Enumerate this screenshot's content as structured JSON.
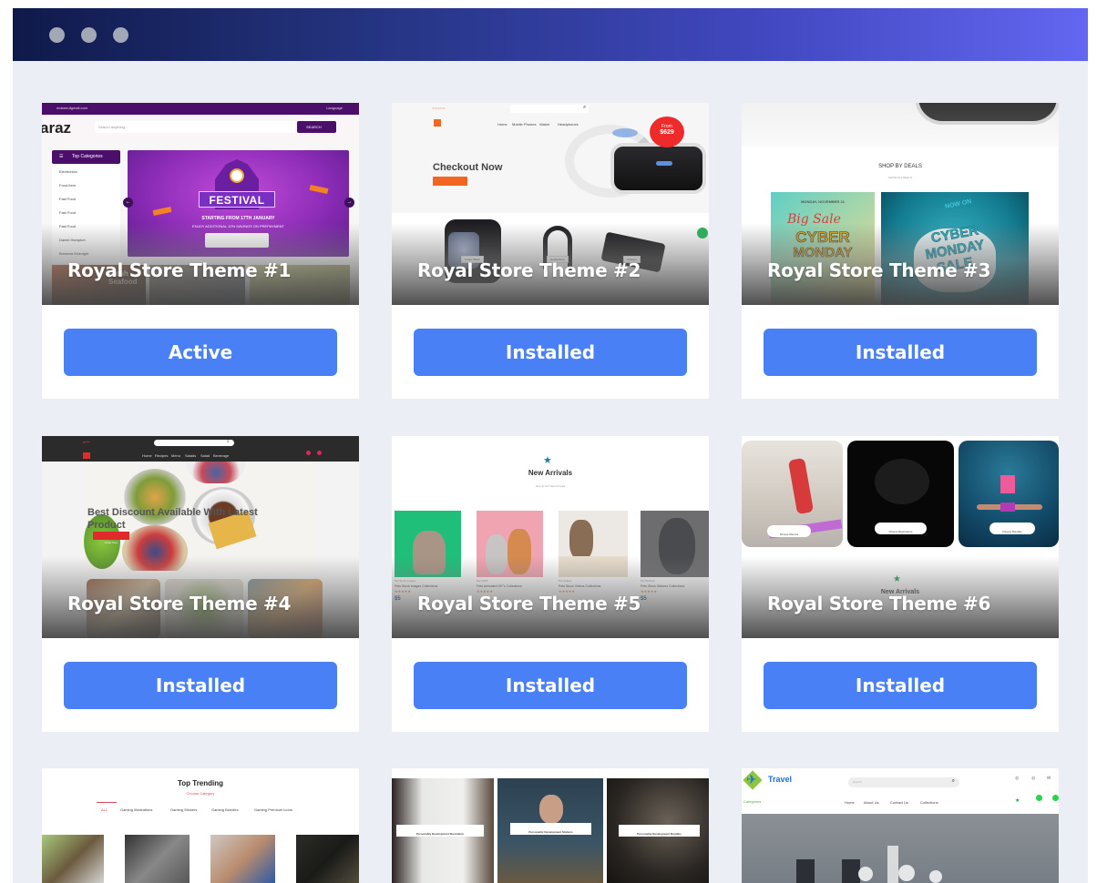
{
  "window": {
    "controls": [
      "close-dot",
      "minimize-dot",
      "maximize-dot"
    ]
  },
  "themes": [
    {
      "title": "Royal Store Theme #1",
      "button": "Active",
      "preview": {
        "email": "mdamrufgmail.com",
        "language": "Language",
        "logo": "araz",
        "search_placeholder": "Search anything...",
        "search_button": "SEARCH",
        "categories_header": "Top Categories",
        "categories": [
          "Electronics",
          "Food Item",
          "Fast Food",
          "Fast Food",
          "Fast Food",
          "Daniel Hampton",
          "Breanna Mcknight"
        ],
        "banner_title": "FESTIVAL",
        "banner_line1": "STARTING FROM 17TH JANUARY",
        "banner_line2": "ENJOY ADDITIONAL 10% SAVINGS ON PREPAYMENT",
        "tile_text": "Fresh Seafood"
      }
    },
    {
      "title": "Royal Store Theme #2",
      "button": "Installed",
      "preview": {
        "nav": [
          "Home",
          "Mobile Phones",
          "Watch",
          "Headphones"
        ],
        "hero_title": "Checkout Now",
        "hero_button": "Shop Now",
        "price_from": "From",
        "price": "$629",
        "product_labels": [
          "Smart Watch",
          "Headphone",
          "Charger"
        ]
      }
    },
    {
      "title": "Royal Store Theme #3",
      "button": "Installed",
      "preview": {
        "section_title": "SHOP BY DEALS",
        "section_sub": "SHOW ALL DEALS",
        "deal1_date": "MONDAY, NOVEMBER 21",
        "deal1_script": "Big Sale",
        "deal1_line1": "CYBER",
        "deal1_line2": "MONDAY",
        "deal2_top": "NOW ON",
        "deal2_line1": "CYBER",
        "deal2_line2": "MONDAY",
        "deal2_line3": "SALE"
      }
    },
    {
      "title": "Royal Store Theme #4",
      "button": "Installed",
      "preview": {
        "nav": [
          "Home",
          "Recipes",
          "Menu",
          "Salads",
          "Salad",
          "Beverage"
        ],
        "hero_title": "Best Discount Available With Latest Product",
        "hero_button": "Order Now"
      }
    },
    {
      "title": "Royal Store Theme #5",
      "button": "Installed",
      "preview": {
        "section_title": "New Arrivals",
        "section_sub": "Get Up For New Arrivals",
        "products": [
          {
            "category": "Pet Stock Images",
            "name": "Pets Stock Images Collections",
            "price": "$5"
          },
          {
            "category": "Pet GIFS",
            "name": "Pets Animated GIF's Collections",
            "price": ""
          },
          {
            "category": "Pet Videos",
            "name": "Pets Stock Videos Collections",
            "price": ""
          },
          {
            "category": "Pet Stickers",
            "name": "Pets Stock Stickers Collections",
            "price": "$5"
          }
        ]
      }
    },
    {
      "title": "Royal Store Theme #6",
      "button": "Installed",
      "preview": {
        "tiles": [
          "Fitness Memes",
          "Fitness Illustrations",
          "Fitness Bundles"
        ],
        "section_title": "New Arrivals"
      }
    },
    {
      "title": "",
      "button": "",
      "preview": {
        "section_title": "Top Trending",
        "section_sub": "Choose Category",
        "tabs": [
          "ALL",
          "Gaming Illustrations",
          "Gaming Stickers",
          "Gaming Bundles",
          "Gaming Premium Icons"
        ]
      }
    },
    {
      "title": "",
      "button": "",
      "preview": {
        "tiles": [
          "Personality Development Illustration",
          "Personality Development Stickers",
          "Personality Development Bundles"
        ]
      }
    },
    {
      "title": "",
      "button": "",
      "preview": {
        "logo": "Travel",
        "search_placeholder": "Search",
        "categories": "Categories",
        "nav": [
          "Home",
          "About Us",
          "Contact Us",
          "Collections"
        ]
      }
    }
  ],
  "colors": {
    "button": "#4a80f5",
    "titlebar_start": "#0f1a4a",
    "titlebar_end": "#6366f1",
    "background": "#eceef6"
  }
}
